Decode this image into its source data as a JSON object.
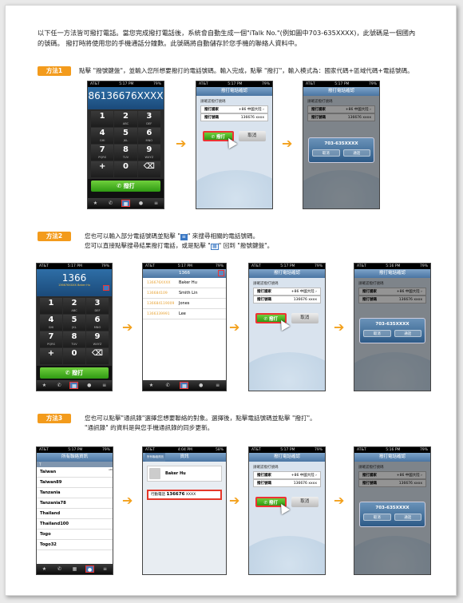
{
  "intro_line1": "以下任一方法皆可撥打電話。當您完成撥打電話後，系統會自動生成一個\"iTalk No.\"(例如圖中703-635XXXX)，此號碼是一個國內",
  "intro_line2": "的號碼。 撥打時將使用您的手機通話分鐘數。此號碼將自動儲存於您手機的聯絡人資料中。",
  "method1": {
    "badge": "方法1",
    "text": "點擊 \"撥號鍵盤\"，並輸入您所想要撥打的電話號碼。輸入完成，點擊 \"撥打\"，輸入模式為：國家代碼+區域代碼+電話號碼。"
  },
  "method2": {
    "badge": "方法2",
    "text1a": "您也可以輸入部分電話號碼並點擊 \"",
    "text1b": "\" 來搜尋相關的電話號碼。",
    "text2a": "您可以直接點擊搜尋結果撥打電話，或是點擊 \"",
    "text2b": "\" 回到 \"撥號鍵盤\"。"
  },
  "method3": {
    "badge": "方法3",
    "text1": "您也可以點擊\"通訊錄\"選擇您想要聯絡的對象。選擇後，點擊電話號碼並點擊 \"撥打\"。",
    "text2": "\"通訊錄\" 的資料是與您手機通訊錄的同步更新。"
  },
  "status": {
    "carrier": "AT&T",
    "time1": "5:17 PM",
    "time2": "5:16 PM",
    "time3": "4:04 PM",
    "battery": "79%",
    "battery2": "58%"
  },
  "dialpad": {
    "number1": "86136676XXXX",
    "number2": "1366",
    "sub2": "136676XXXX Baker Hu",
    "call": "撥打",
    "keys": [
      {
        "d": "1",
        "l": ""
      },
      {
        "d": "2",
        "l": "ABC"
      },
      {
        "d": "3",
        "l": "DEF"
      },
      {
        "d": "4",
        "l": "GHI"
      },
      {
        "d": "5",
        "l": "JKL"
      },
      {
        "d": "6",
        "l": "MNO"
      },
      {
        "d": "7",
        "l": "PQRS"
      },
      {
        "d": "8",
        "l": "TUV"
      },
      {
        "d": "9",
        "l": "WXYZ"
      },
      {
        "d": "+",
        "l": ""
      },
      {
        "d": "0",
        "l": ""
      },
      {
        "d": "⌫",
        "l": ""
      }
    ]
  },
  "confirm": {
    "title": "撥打電話確認",
    "prompt": "請確認撥打號碼",
    "country_label": "撥打國家",
    "country_value": "+86 中國大陸 ›",
    "phone_label": "撥打號碼",
    "phone_value": "136676 xxxx",
    "dial": "撥打",
    "cancel": "取消",
    "italk": "703-635XXXX",
    "alert_cancel": "取消",
    "alert_call": "通話"
  },
  "search": {
    "header": "1366",
    "results": [
      {
        "n": "136676XXXX",
        "name": "Baker Hu"
      },
      {
        "n": "136684109",
        "name": "Smith Lin"
      },
      {
        "n": "136684119009",
        "name": "Jones"
      },
      {
        "n": "1366339991",
        "name": "Lee"
      }
    ]
  },
  "contacts": {
    "header": "所有聯絡資訊",
    "section": "T",
    "names": [
      "Taiwan",
      "Taiwan89",
      "Tanzania",
      "Tanzania78",
      "Thailand",
      "Thailand100",
      "Togo",
      "Togo32"
    ],
    "index": "ABCDEFGHIJKLMNOPQRSTUVWXYZ#"
  },
  "detail": {
    "nav_left": "所有聯絡資訊",
    "nav_title": "資訊",
    "name": "Baker Hu",
    "num_label": "行動電話",
    "num_value": "136676",
    "num_suffix": "XXXX"
  }
}
